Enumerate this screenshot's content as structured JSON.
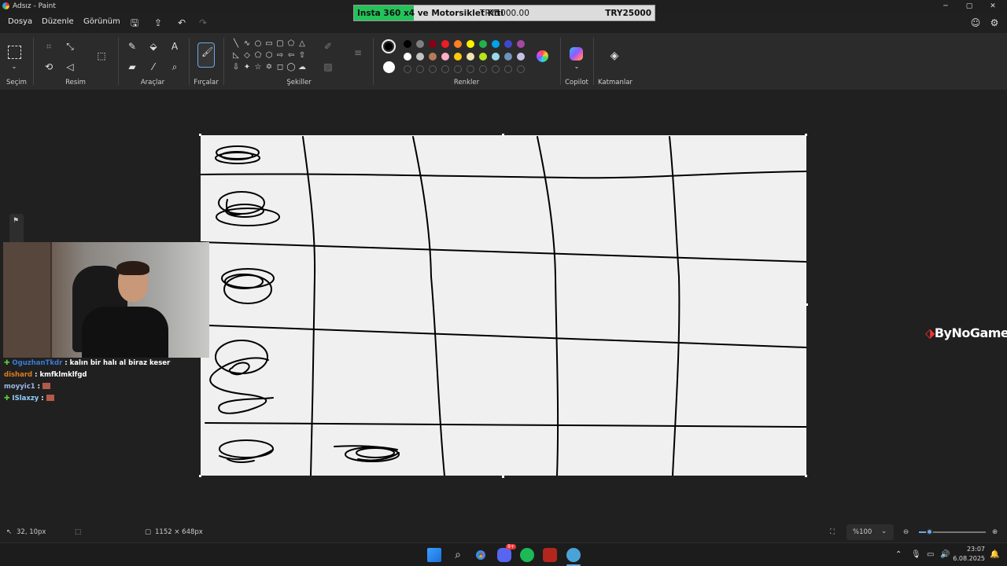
{
  "window": {
    "title": "Adsız - Paint"
  },
  "menu": {
    "file": "Dosya",
    "edit": "Düzenle",
    "view": "Görünüm"
  },
  "banner": {
    "title": "Insta 360 x4 ve Motorsiklet Kiti",
    "current": "TRY5000.00",
    "goal": "TRY25000",
    "progress_fraction": 0.2,
    "color": "#25c25a"
  },
  "ribbon": {
    "groups": {
      "selection": "Seçim",
      "image": "Resim",
      "tools": "Araçlar",
      "brushes": "Fırçalar",
      "shapes": "Şekiller",
      "colors": "Renkler",
      "copilot": "Copilot",
      "layers": "Katmanlar"
    },
    "palette_row1": [
      "#000000",
      "#7f7f7f",
      "#880015",
      "#ed1c24",
      "#ff7f27",
      "#fff200",
      "#22b14c",
      "#00a2e8",
      "#3f48cc",
      "#a349a4"
    ],
    "palette_row2": [
      "#ffffff",
      "#c3c3c3",
      "#b97a57",
      "#ffaec9",
      "#ffc90e",
      "#efe4b0",
      "#b5e61d",
      "#99d9ea",
      "#7092be",
      "#c8bfe7"
    ],
    "primary_color": "#000000",
    "secondary_color": "#ffffff"
  },
  "chat": [
    {
      "user": "OguzhanTkdr",
      "user_color": "#3b7bd6",
      "badge": true,
      "message": "kalın bir halı al biraz keser",
      "emote": false
    },
    {
      "user": "dishard",
      "user_color": "#e07b1f",
      "badge": false,
      "message": "kmfklmklfgd",
      "emote": false
    },
    {
      "user": "moyyic1",
      "user_color": "#9bb7e6",
      "badge": false,
      "message": "",
      "emote": true
    },
    {
      "user": "ISlaxzy",
      "user_color": "#8fd0ff",
      "badge": true,
      "message": "",
      "emote": true
    }
  ],
  "logo": {
    "text": "ByNoGame"
  },
  "status": {
    "cursor": "32, 10px",
    "canvas_size": "1152 × 648px",
    "zoom": "%100"
  },
  "taskbar": {
    "time": "23:07",
    "date": "6.08.2025",
    "discord_badge": "9+",
    "apps": [
      "start-icon",
      "search-icon",
      "chrome-icon",
      "discord-icon",
      "spotify-icon",
      "app-icon",
      "paint-icon"
    ]
  }
}
